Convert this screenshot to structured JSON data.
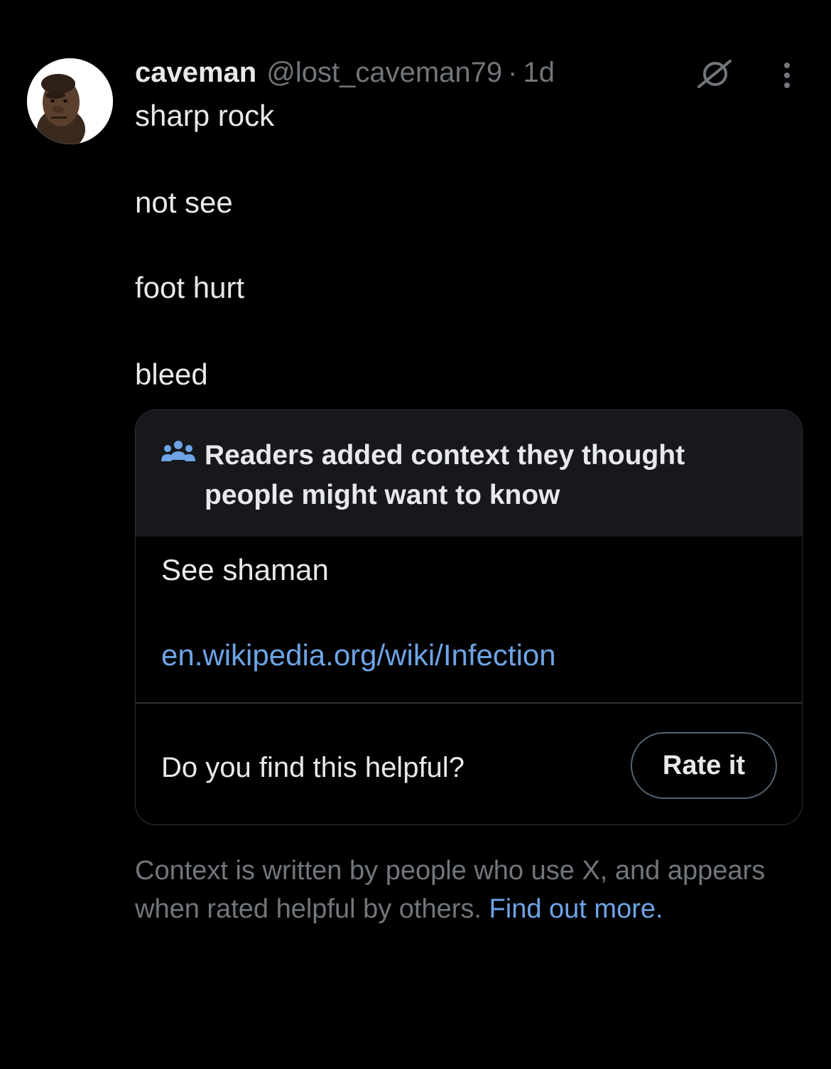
{
  "post": {
    "author_name": "caveman",
    "handle": "@lost_caveman79",
    "separator": "·",
    "time": "1d",
    "lines": [
      "sharp rock",
      "not see",
      "foot hurt",
      "bleed"
    ]
  },
  "icons": {
    "avatar": "caveman-avatar",
    "grok": "grok-icon",
    "more": "more-vertical-icon",
    "people": "people-group-icon"
  },
  "community_note": {
    "title": "Readers added context they thought people might want to know",
    "body": "See shaman",
    "link": "en.wikipedia.org/wiki/Infection",
    "question": "Do you find this helpful?",
    "rate_button": "Rate it"
  },
  "footer": {
    "text": "Context is written by people who use X, and appears when rated helpful by others.",
    "link": "Find out more."
  },
  "colors": {
    "background": "#000000",
    "text_primary": "#e7e9ea",
    "text_secondary": "#71767b",
    "link": "#6ea4e6",
    "note_header_bg": "#16181c",
    "border": "#2f3336"
  }
}
